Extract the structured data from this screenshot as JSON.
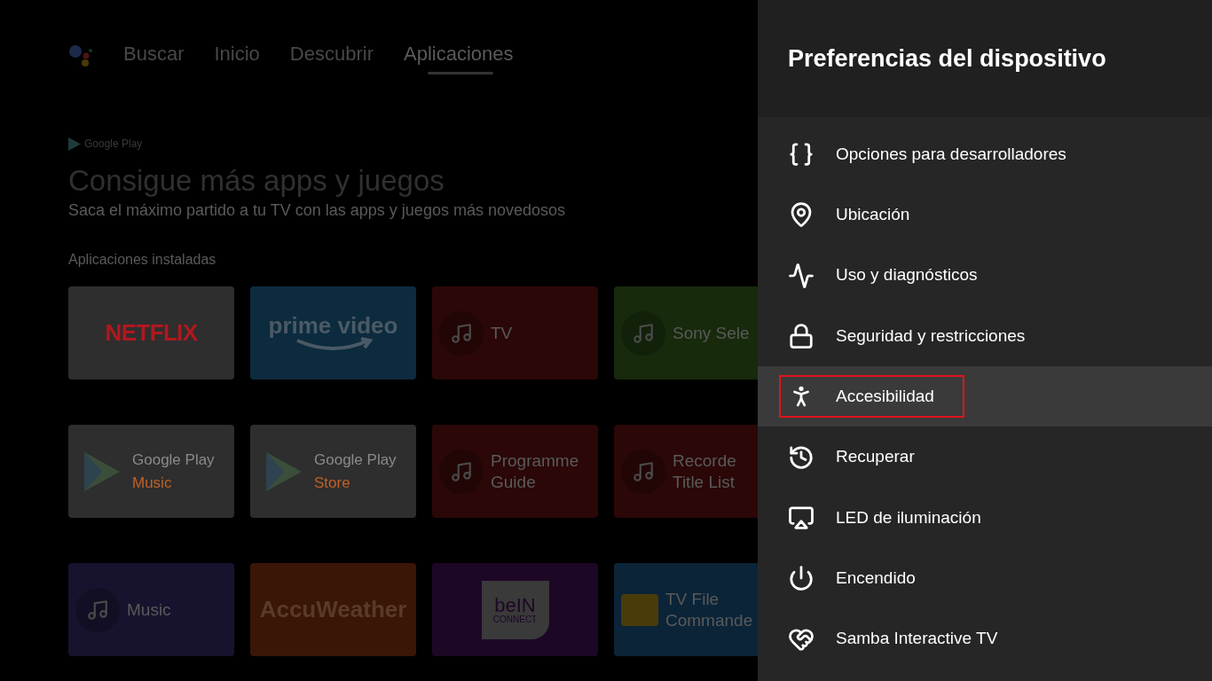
{
  "top_nav": {
    "tabs": [
      {
        "label": "Buscar",
        "selected": false
      },
      {
        "label": "Inicio",
        "selected": false
      },
      {
        "label": "Descubrir",
        "selected": false
      },
      {
        "label": "Aplicaciones",
        "selected": true
      }
    ]
  },
  "promo": {
    "brand": "Google Play",
    "title": "Consigue más apps y juegos",
    "subtitle": "Saca el máximo partido a tu TV con las apps y juegos más novedosos"
  },
  "installed": {
    "heading": "Aplicaciones instaladas",
    "rows": [
      [
        {
          "kind": "wordmark",
          "lines": [
            "NETFLIX"
          ],
          "color": "#2e2e2e"
        },
        {
          "kind": "wordmark-arrow",
          "lines": [
            "prime video"
          ],
          "color": "#0d2b3e"
        },
        {
          "kind": "app",
          "lines": [
            "TV"
          ],
          "color": "#2b0707"
        },
        {
          "kind": "app",
          "lines": [
            "Sony Sele"
          ],
          "color": "#172a0c"
        }
      ],
      [
        {
          "kind": "play",
          "lines": [
            "Google Play",
            "Music"
          ],
          "color": "#2e2e2e"
        },
        {
          "kind": "play",
          "lines": [
            "Google Play",
            "Store"
          ],
          "color": "#2e2e2e"
        },
        {
          "kind": "app",
          "lines": [
            "Programme",
            "Guide"
          ],
          "color": "#2b0707"
        },
        {
          "kind": "app",
          "lines": [
            "Recorde",
            "Title List"
          ],
          "color": "#2b0707"
        }
      ],
      [
        {
          "kind": "app",
          "lines": [
            "Music"
          ],
          "color": "#17132e"
        },
        {
          "kind": "wordmark",
          "lines": [
            "AccuWeather"
          ],
          "color": "#3a1606"
        },
        {
          "kind": "badge",
          "lines": [
            "beIN",
            "CONNECT"
          ],
          "color": "#1d0726"
        },
        {
          "kind": "folder",
          "lines": [
            "TV File",
            "Commande"
          ],
          "color": "#0b2438"
        }
      ]
    ]
  },
  "panel": {
    "title": "Preferencias del dispositivo",
    "items": [
      {
        "label": "Opciones para desarrolladores",
        "selected": false
      },
      {
        "label": "Ubicación",
        "selected": false
      },
      {
        "label": "Uso y diagnósticos",
        "selected": false
      },
      {
        "label": "Seguridad y restricciones",
        "selected": false
      },
      {
        "label": "Accesibilidad",
        "selected": true
      },
      {
        "label": "Recuperar",
        "selected": false
      },
      {
        "label": "LED de iluminación",
        "selected": false
      },
      {
        "label": "Encendido",
        "selected": false
      },
      {
        "label": "Samba Interactive TV",
        "selected": false
      }
    ]
  }
}
